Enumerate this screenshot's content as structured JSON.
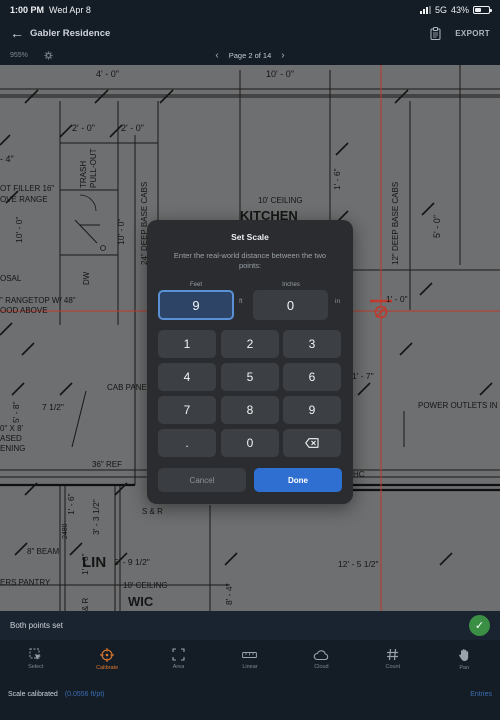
{
  "status_bar": {
    "time": "1:00 PM",
    "date": "Wed Apr 8",
    "network": "5G",
    "battery": "43%",
    "battery_level": 0.43
  },
  "header": {
    "title": "Gabler Residence",
    "export_label": "EXPORT"
  },
  "subheader": {
    "zoom": "955%",
    "page": "Page 2 of 14"
  },
  "drawing": {
    "labels": [
      "4' - 0\"",
      "10' - 0\"",
      "2' - 0\"",
      "2' - 0\"",
      "- 4\"",
      "TRASH",
      "PULL-OUT",
      "OT FILLER 16\"",
      "OVE RANGE",
      "10' CEILING",
      "KITCHEN",
      "1' - 6\"",
      "5' - 0\"",
      "24\" DEEP BASE CABS",
      "12\" DEEP BASE CABS",
      "10' - 0\"",
      "10' - 0\"",
      "DW",
      "OSAL",
      "\" RANGETOP W/ 48\"",
      "OOD ABOVE",
      "1' - 0\"",
      "1' - 7\"",
      "CAB PANE",
      "5' - 8\"",
      "7 1/2\"",
      "POWER OUTLETS IN",
      "0\" X 8'",
      "ASED",
      "ENING",
      "36\" REF",
      "HC",
      "S & R",
      "2480",
      "1' - 6\"",
      "3' - 3 1/2\"",
      "8\" BEAM",
      "LIN",
      "5' - 9 1/2\"",
      "12' - 5 1/2\"",
      "ERS PANTRY",
      "10' CEILING",
      "WIC",
      "8' - 4\"",
      "& R",
      "1' - 6\""
    ]
  },
  "modal": {
    "title": "Set Scale",
    "instruction": "Enter the real-world distance between the two points:",
    "feet_label": "Feet",
    "inches_label": "Inches",
    "feet_value": "9",
    "inches_value": "0",
    "feet_unit": "ft",
    "inches_unit": "in",
    "keys": [
      "1",
      "2",
      "3",
      "4",
      "5",
      "6",
      "7",
      "8",
      "9",
      ".",
      "0"
    ],
    "cancel_label": "Cancel",
    "done_label": "Done"
  },
  "banner": {
    "text": "Both points set"
  },
  "tools": [
    {
      "label": "Select",
      "icon": "select-icon",
      "active": false
    },
    {
      "label": "Calibrate",
      "icon": "crosshair-icon",
      "active": true
    },
    {
      "label": "Area",
      "icon": "area-icon",
      "active": false
    },
    {
      "label": "Linear",
      "icon": "ruler-icon",
      "active": false
    },
    {
      "label": "Cloud",
      "icon": "cloud-icon",
      "active": false
    },
    {
      "label": "Count",
      "icon": "hash-icon",
      "active": false
    },
    {
      "label": "Pan",
      "icon": "hand-icon",
      "active": false
    }
  ],
  "footer": {
    "status": "Scale calibrated",
    "scale": "(0.0556 ft/pt)",
    "entries_label": "Entries"
  },
  "colors": {
    "accent": "#2f6fd1",
    "active_tool": "#e07b2e",
    "success": "#3b8f44",
    "redline": "#c0392b"
  }
}
